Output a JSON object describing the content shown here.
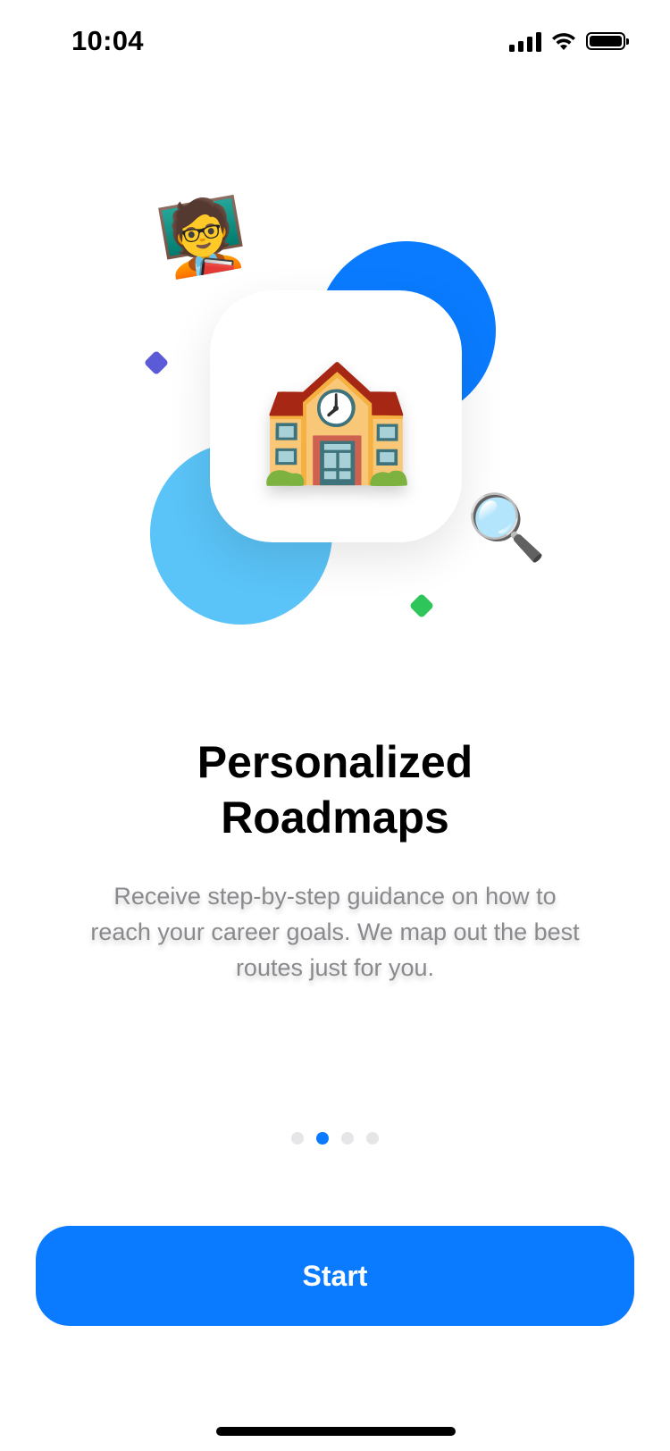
{
  "status_bar": {
    "time": "10:04",
    "icons": [
      "signal-icon",
      "wifi-icon",
      "battery-icon"
    ]
  },
  "illustration": {
    "center_icon": "🏫",
    "top_left_icon": "🧑‍🏫",
    "bottom_right_icon": "🔍",
    "colors": {
      "blue_circle": "#0A7BFF",
      "light_blue_circle": "#5AC3F7",
      "purple_diamond": "#5B5BD8",
      "green_diamond": "#2EC65A"
    }
  },
  "onboarding": {
    "title": "Personalized\nRoadmaps",
    "description": "Receive step-by-step guidance on how to reach your career goals. We map out the best routes just for you."
  },
  "pagination": {
    "total": 4,
    "active_index": 1,
    "active_color": "#0A7BFF",
    "inactive_color": "#E6E6E9"
  },
  "actions": {
    "start_label": "Start",
    "accent_color": "#0A7BFF"
  }
}
